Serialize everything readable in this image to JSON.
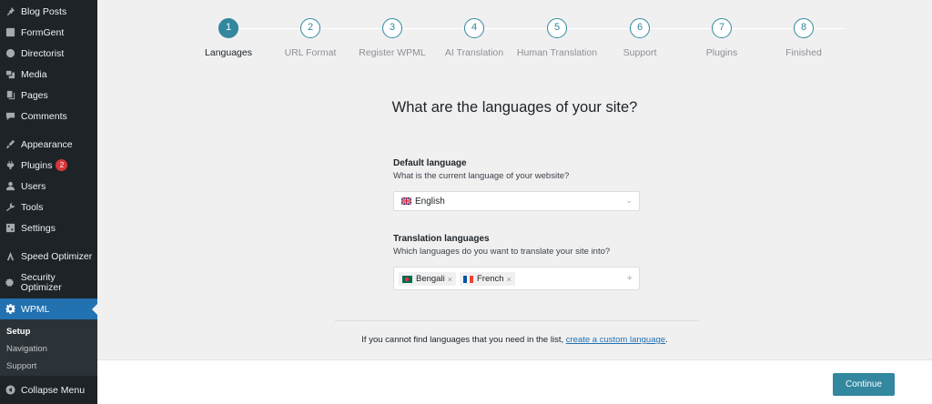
{
  "sidebar": {
    "items": [
      {
        "label": "Blog Posts",
        "icon": "pin-icon"
      },
      {
        "label": "FormGent",
        "icon": "form-icon"
      },
      {
        "label": "Directorist",
        "icon": "directory-icon"
      },
      {
        "label": "Media",
        "icon": "media-icon"
      },
      {
        "label": "Pages",
        "icon": "pages-icon"
      },
      {
        "label": "Comments",
        "icon": "comments-icon"
      },
      {
        "label": "Appearance",
        "icon": "appearance-icon"
      },
      {
        "label": "Plugins",
        "icon": "plugins-icon",
        "badge": "2"
      },
      {
        "label": "Users",
        "icon": "users-icon"
      },
      {
        "label": "Tools",
        "icon": "tools-icon"
      },
      {
        "label": "Settings",
        "icon": "settings-icon"
      },
      {
        "label": "Speed Optimizer",
        "icon": "speed-icon"
      },
      {
        "label": "Security Optimizer",
        "icon": "security-icon"
      },
      {
        "label": "WPML",
        "icon": "wpml-gear-icon"
      }
    ],
    "submenu": [
      "Setup",
      "Navigation",
      "Support"
    ],
    "collapse_label": "Collapse Menu"
  },
  "steps": [
    {
      "number": "1",
      "label": "Languages"
    },
    {
      "number": "2",
      "label": "URL Format"
    },
    {
      "number": "3",
      "label": "Register WPML"
    },
    {
      "number": "4",
      "label": "AI Translation"
    },
    {
      "number": "5",
      "label": "Human Translation"
    },
    {
      "number": "6",
      "label": "Support"
    },
    {
      "number": "7",
      "label": "Plugins"
    },
    {
      "number": "8",
      "label": "Finished"
    }
  ],
  "active_step": "1",
  "heading": "What are the languages of your site?",
  "default_language": {
    "title": "Default language",
    "description": "What is the current language of your website?",
    "selected": "English"
  },
  "translation_languages": {
    "title": "Translation languages",
    "description": "Which languages do you want to translate your site into?",
    "selected": [
      "Bengali",
      "French"
    ],
    "remove_symbol": "×",
    "add_symbol": "+"
  },
  "note": {
    "text": "If you cannot find languages that you need in the list, ",
    "link": "create a custom language",
    "end": "."
  },
  "continue_label": "Continue",
  "colors": {
    "accent": "#33879e",
    "sidebar_bg": "#1d2327",
    "active_menu": "#2271b1",
    "badge": "#d63638"
  }
}
